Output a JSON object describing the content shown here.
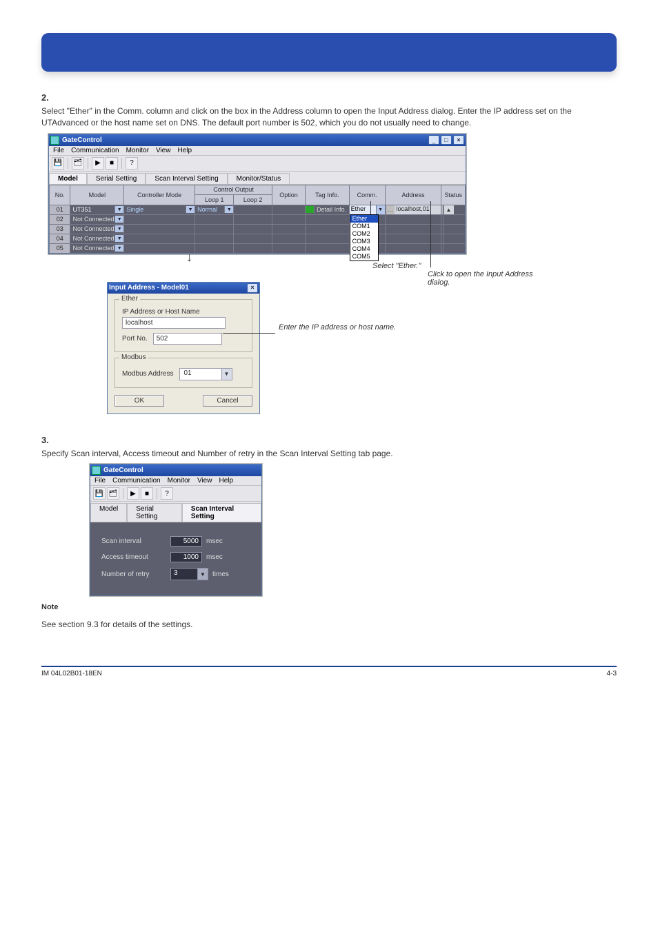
{
  "page": {
    "section_number_1": "2.",
    "section_text_1": "Select \"Ether\" in the Comm. column and click on the box in the Address column to open the Input Address dialog. Enter the IP address set on the UTAdvanced or the host name set on DNS. The default port number is 502, which you do not usually need to change.",
    "section_number_2": "3.",
    "section_text_2": "Specify Scan interval, Access timeout and Number of retry in the Scan Interval Setting tab page.",
    "note_label": "Note",
    "note_text": "See section 9.3 for details of the settings.",
    "footer_left": "IM 04L02B01-18EN",
    "footer_right": "4-3"
  },
  "mainwin": {
    "title": "GateControl",
    "menu": [
      "File",
      "Communication",
      "Monitor",
      "View",
      "Help"
    ],
    "tabs": [
      "Model",
      "Serial Setting",
      "Scan Interval Setting",
      "Monitor/Status"
    ],
    "active_tab": 0,
    "headers": {
      "no": "No.",
      "model": "Model",
      "controller_mode": "Controller Mode",
      "control_output_group": "Control Output",
      "loop1": "Loop 1",
      "loop2": "Loop 2",
      "option": "Option",
      "tag_info": "Tag Info.",
      "comm": "Comm.",
      "address": "Address",
      "status": "Status"
    },
    "rows": [
      {
        "no": "01",
        "model": "UT351",
        "mode": "Single",
        "loop1": "Normal",
        "loop2": "",
        "option": "",
        "taginfo": "Detail Info.",
        "comm": "Ether",
        "address": "localhost,01",
        "status": ""
      },
      {
        "no": "02",
        "model": "Not Connected",
        "mode": "",
        "loop1": "",
        "loop2": "",
        "option": "",
        "taginfo": "",
        "comm": "",
        "address": "",
        "status": ""
      },
      {
        "no": "03",
        "model": "Not Connected",
        "mode": "",
        "loop1": "",
        "loop2": "",
        "option": "",
        "taginfo": "",
        "comm": "",
        "address": "",
        "status": ""
      },
      {
        "no": "04",
        "model": "Not Connected",
        "mode": "",
        "loop1": "",
        "loop2": "",
        "option": "",
        "taginfo": "",
        "comm": "",
        "address": "",
        "status": ""
      },
      {
        "no": "05",
        "model": "Not Connected",
        "mode": "",
        "loop1": "",
        "loop2": "",
        "option": "",
        "taginfo": "",
        "comm": "",
        "address": "",
        "status": ""
      }
    ],
    "comm_options": [
      "Ether",
      "COM1",
      "COM2",
      "COM3",
      "COM4",
      "COM5"
    ]
  },
  "dialog": {
    "title": "Input Address - Model01",
    "ether_legend": "Ether",
    "ip_label": "IP Address or Host Name",
    "ip_value": "localhost",
    "port_label": "Port No.",
    "port_value": "502",
    "modbus_legend": "Modbus",
    "modbus_label": "Modbus Address",
    "modbus_value": "01",
    "ok": "OK",
    "cancel": "Cancel"
  },
  "scanwin": {
    "title": "GateControl",
    "menu": [
      "File",
      "Communication",
      "Monitor",
      "View",
      "Help"
    ],
    "tabs": [
      "Model",
      "Serial Setting",
      "Scan Interval Setting"
    ],
    "active_tab": 2,
    "scan_interval_label": "Scan interval",
    "scan_interval_value": "5000",
    "msec": "msec",
    "access_timeout_label": "Access timeout",
    "access_timeout_value": "1000",
    "retry_label": "Number of retry",
    "retry_value": "3",
    "times": "times"
  },
  "callouts": {
    "enter_ip": "Enter the IP address or host name.",
    "select_ether": "Select \"Ether.\"",
    "click_address": "Click to open the Input Address dialog."
  },
  "icons": {
    "save": "💾",
    "disk2": "🗂",
    "run": "▶",
    "stop": "■",
    "help": "?"
  }
}
